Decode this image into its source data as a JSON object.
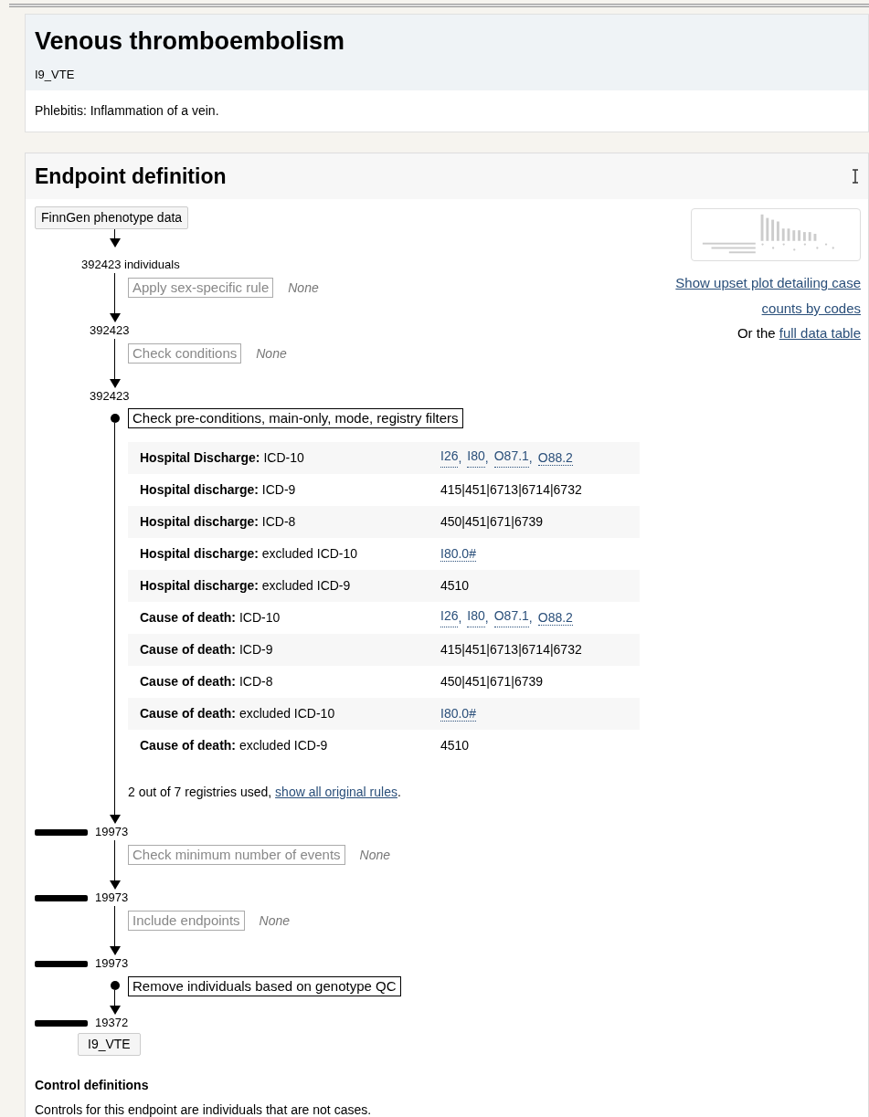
{
  "header": {
    "title": "Venous thromboembolism",
    "code": "I9_VTE",
    "description": "Phlebitis: Inflammation of a vein."
  },
  "definition": {
    "title": "Endpoint definition",
    "flow": [
      {
        "kind": "source",
        "label": "FinnGen phenotype data"
      },
      {
        "kind": "count",
        "text": "392423 individuals",
        "bar": false
      },
      {
        "kind": "step",
        "label": "Apply sex-specific rule",
        "active": false,
        "note": "None"
      },
      {
        "kind": "count",
        "text": "392423",
        "bar": false
      },
      {
        "kind": "step",
        "label": "Check conditions",
        "active": false,
        "note": "None"
      },
      {
        "kind": "count",
        "text": "392423",
        "bar": false
      },
      {
        "kind": "step",
        "label": "Check pre-conditions, main-only, mode, registry filters",
        "active": true,
        "rules": [
          {
            "source": "Hospital Discharge:",
            "type": "ICD-10",
            "codes": [
              "I26",
              "I80",
              "O87.1",
              "O88.2"
            ],
            "linked": true
          },
          {
            "source": "Hospital discharge:",
            "type": "ICD-9",
            "codes": [
              "415|451|6713|6714|6732"
            ],
            "linked": false
          },
          {
            "source": "Hospital discharge:",
            "type": "ICD-8",
            "codes": [
              "450|451|671|6739"
            ],
            "linked": false
          },
          {
            "source": "Hospital discharge:",
            "type": "excluded ICD-10",
            "codes": [
              "I80.0#"
            ],
            "linked": true
          },
          {
            "source": "Hospital discharge:",
            "type": "excluded ICD-9",
            "codes": [
              "4510"
            ],
            "linked": false
          },
          {
            "source": "Cause of death:",
            "type": "ICD-10",
            "codes": [
              "I26",
              "I80",
              "O87.1",
              "O88.2"
            ],
            "linked": true
          },
          {
            "source": "Cause of death:",
            "type": "ICD-9",
            "codes": [
              "415|451|6713|6714|6732"
            ],
            "linked": false
          },
          {
            "source": "Cause of death:",
            "type": "ICD-8",
            "codes": [
              "450|451|671|6739"
            ],
            "linked": false
          },
          {
            "source": "Cause of death:",
            "type": "excluded ICD-10",
            "codes": [
              "I80.0#"
            ],
            "linked": true
          },
          {
            "source": "Cause of death:",
            "type": "excluded ICD-9",
            "codes": [
              "4510"
            ],
            "linked": false
          }
        ],
        "separator": ",",
        "footnote": {
          "text": "2 out of 7 registries used,",
          "link": "show all original rules",
          "end": "."
        }
      },
      {
        "kind": "count",
        "text": "19973",
        "bar": true
      },
      {
        "kind": "step",
        "label": "Check minimum number of events",
        "active": false,
        "note": "None"
      },
      {
        "kind": "count",
        "text": "19973",
        "bar": true
      },
      {
        "kind": "step",
        "label": "Include endpoints",
        "active": false,
        "note": "None"
      },
      {
        "kind": "count",
        "text": "19973",
        "bar": true
      },
      {
        "kind": "step",
        "label": "Remove individuals based on genotype QC",
        "active": true
      },
      {
        "kind": "count",
        "text": "19372",
        "bar": true
      },
      {
        "kind": "result",
        "label": "I9_VTE"
      }
    ],
    "upset": {
      "link": "Show upset plot detailing case counts by codes",
      "prefix": "Or the",
      "table_link": "full data table"
    }
  },
  "controls": {
    "title": "Control definitions",
    "text": "Controls for this endpoint are individuals that are not cases."
  }
}
